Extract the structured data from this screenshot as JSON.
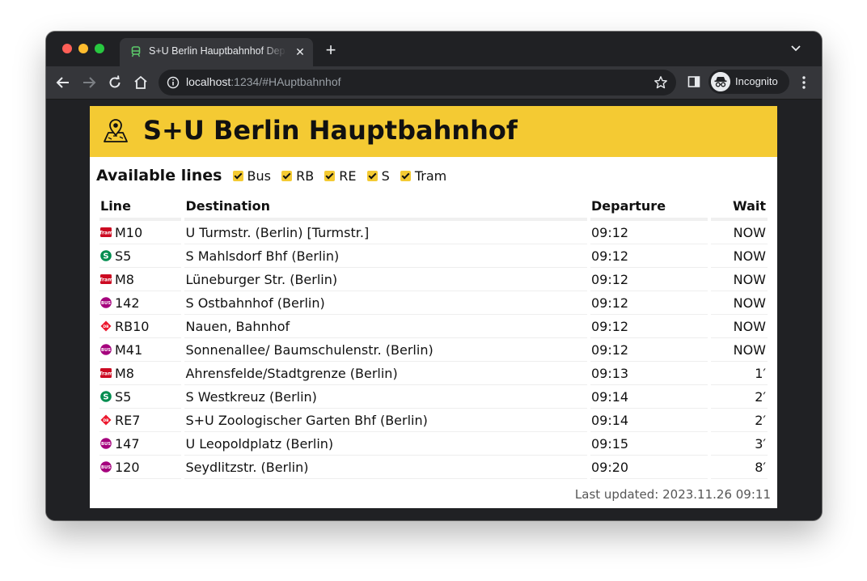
{
  "browser": {
    "tab_title": "S+U Berlin Hauptbahnhof Departures",
    "url_host": "localhost",
    "url_rest": ":1234/#HAuptbahnhof",
    "profile_label": "Incognito"
  },
  "station": {
    "name": "S+U Berlin Hauptbahnhof",
    "icon": "map-pin-icon"
  },
  "filters": {
    "title": "Available lines",
    "items": [
      {
        "label": "Bus",
        "checked": true
      },
      {
        "label": "RB",
        "checked": true
      },
      {
        "label": "RE",
        "checked": true
      },
      {
        "label": "S",
        "checked": true
      },
      {
        "label": "Tram",
        "checked": true
      }
    ]
  },
  "table": {
    "headers": {
      "line": "Line",
      "destination": "Destination",
      "departure": "Departure",
      "wait": "Wait"
    },
    "rows": [
      {
        "type": "tram",
        "line": "M10",
        "destination": "U Turmstr. (Berlin) [Turmstr.]",
        "departure": "09:12",
        "wait": "NOW"
      },
      {
        "type": "sbahn",
        "line": "S5",
        "destination": "S Mahlsdorf Bhf (Berlin)",
        "departure": "09:12",
        "wait": "NOW"
      },
      {
        "type": "tram",
        "line": "M8",
        "destination": "Lüneburger Str. (Berlin)",
        "departure": "09:12",
        "wait": "NOW"
      },
      {
        "type": "bus",
        "line": "142",
        "destination": "S Ostbahnhof (Berlin)",
        "departure": "09:12",
        "wait": "NOW"
      },
      {
        "type": "regional",
        "line": "RB10",
        "destination": "Nauen, Bahnhof",
        "departure": "09:12",
        "wait": "NOW"
      },
      {
        "type": "bus",
        "line": "M41",
        "destination": "Sonnenallee/ Baumschulenstr. (Berlin)",
        "departure": "09:12",
        "wait": "NOW"
      },
      {
        "type": "tram",
        "line": "M8",
        "destination": "Ahrensfelde/Stadtgrenze (Berlin)",
        "departure": "09:13",
        "wait": "1′"
      },
      {
        "type": "sbahn",
        "line": "S5",
        "destination": "S Westkreuz (Berlin)",
        "departure": "09:14",
        "wait": "2′"
      },
      {
        "type": "regional",
        "line": "RE7",
        "destination": "S+U Zoologischer Garten Bhf (Berlin)",
        "departure": "09:14",
        "wait": "2′"
      },
      {
        "type": "bus",
        "line": "147",
        "destination": "U Leopoldplatz (Berlin)",
        "departure": "09:15",
        "wait": "3′"
      },
      {
        "type": "bus",
        "line": "120",
        "destination": "Seydlitzstr. (Berlin)",
        "departure": "09:20",
        "wait": "8′"
      }
    ]
  },
  "footer": {
    "last_updated": "Last updated: 2023.11.26 09:11"
  },
  "colors": {
    "accent": "#f4ca33",
    "tram": "#cc0a22",
    "sbahn": "#008d4f",
    "bus": "#a5027d",
    "regional": "#ec192e"
  }
}
